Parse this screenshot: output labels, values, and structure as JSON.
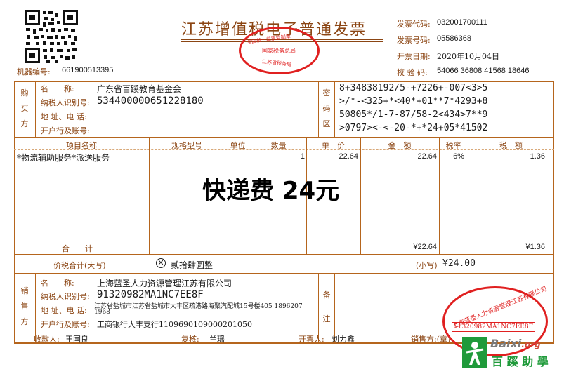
{
  "header": {
    "title": "江苏增值税电子普通发票",
    "machine_label": "机器编号:",
    "machine_no": "661900513395",
    "invoice_code_label": "发票代码:",
    "invoice_code": "032001700111",
    "invoice_no_label": "发票号码:",
    "invoice_no": "05586368",
    "date_label": "开票日期:",
    "date": "2020年10月04日",
    "check_label": "校 验 码:",
    "check_code": "54066 36808 41568 18646"
  },
  "stamp_top": {
    "line1": "全国统一发票监制章",
    "line2": "国家税务总局",
    "line3": "江苏省税务局"
  },
  "buyer": {
    "side": "购买方",
    "name_label": "名　　称:",
    "name": "广东省百蹊教育基金会",
    "tax_label": "纳税人识别号:",
    "tax_id": "534400000651228180",
    "addr_label": "地 址、电 话:",
    "bank_label": "开户行及账号:"
  },
  "cipher": {
    "side": "密码区",
    "lines": [
      "8+34838192/5-+7226+-007<3>5",
      ">/*-<325+*<40*+01**7*4293+8",
      "50805*/1-7-87/58-2<434>7**9",
      ">0797><-<-20-*+*24+05*41502"
    ]
  },
  "columns": {
    "item": "项目名称",
    "spec": "规格型号",
    "unit": "单位",
    "qty": "数量",
    "price": "单　价",
    "amount": "金　额",
    "rate": "税率",
    "tax": "税　额"
  },
  "item": {
    "name": "*物流辅助服务*派送服务",
    "qty": "1",
    "price": "22.64",
    "amount": "22.64",
    "rate": "6%",
    "tax": "1.36"
  },
  "overlay_note": "快递费 24元",
  "totals": {
    "label": "合　　计",
    "amount": "¥22.64",
    "tax": "¥1.36",
    "total_label": "价税合计(大写)",
    "total_cn": "贰拾肆圆整",
    "small_label": "(小写)",
    "total_num": "¥24.00"
  },
  "seller": {
    "side": "销售方",
    "name_label": "名　　称:",
    "name": "上海蓝圣人力资源管理江苏有限公司",
    "tax_label": "纳税人识别号:",
    "tax_id": "91320982MA1NC7EE8F",
    "addr_label": "地 址、电 话:",
    "addr": "江苏省盐城市江苏省盐城市大丰区疏港路海聚汽配城15号楼405 1896207",
    "addr2": "1968",
    "bank_label": "开户行及账号:",
    "bank": "工商银行大丰支行1109690109000201050",
    "remark_side": "备注"
  },
  "footer": {
    "payee_label": "收款人:",
    "payee": "王国良",
    "review_label": "复核:",
    "review": "兰瑶",
    "drawer_label": "开票人:",
    "drawer": "刘力鑫",
    "seller_label": "销售方:(章)"
  },
  "stamp_seller": {
    "ring": "上海蓝圣人力资源管理江苏有限公司",
    "tax_id": "91320982MA1NC7EE8F"
  },
  "watermark": {
    "brand": "Baixi",
    "tld": ".org",
    "cn": "百 蹊 助 學"
  }
}
